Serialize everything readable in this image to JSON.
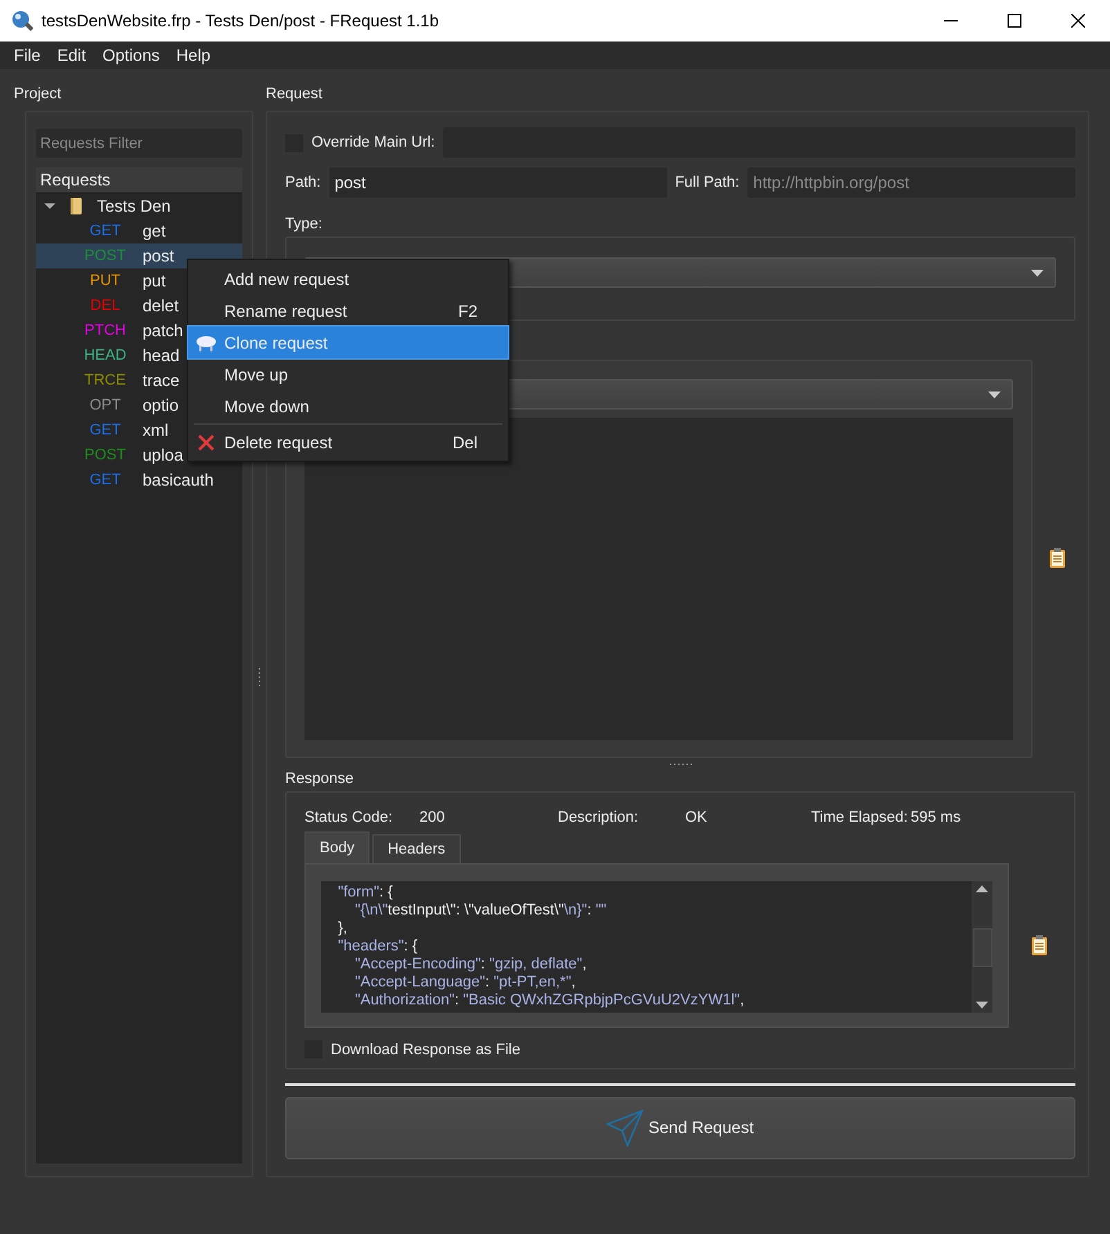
{
  "window": {
    "title": "testsDenWebsite.frp - Tests Den/post - FRequest 1.1b"
  },
  "menu": [
    "File",
    "Edit",
    "Options",
    "Help"
  ],
  "project": {
    "title": "Project",
    "filter_placeholder": "Requests Filter",
    "tree_header": "Requests",
    "tree": [
      {
        "label": "Tests Den",
        "expanded": true,
        "children": [
          {
            "method": "GET",
            "color": "#1e6ee6",
            "name": "get",
            "selected": false
          },
          {
            "method": "POST",
            "color": "#1e8c3c",
            "name": "post",
            "selected": true
          },
          {
            "method": "PUT",
            "color": "#e69600",
            "name": "put",
            "selected": false
          },
          {
            "method": "DEL",
            "color": "#e60000",
            "name": "delet",
            "selected": false
          },
          {
            "method": "PTCH",
            "color": "#e600e6",
            "name": "patch",
            "selected": false
          },
          {
            "method": "HEAD",
            "color": "#3cb482",
            "name": "head",
            "selected": false
          },
          {
            "method": "TRCE",
            "color": "#8c8c00",
            "name": "trace",
            "selected": false
          },
          {
            "method": "OPT",
            "color": "#8c8c8c",
            "name": "optio",
            "selected": false
          },
          {
            "method": "GET",
            "color": "#1e6ee6",
            "name": "xml",
            "selected": false
          },
          {
            "method": "POST",
            "color": "#1e8c1e",
            "name": "uploa",
            "selected": false
          },
          {
            "method": "GET",
            "color": "#1e6ee6",
            "name": "basicauth",
            "selected": false
          }
        ]
      }
    ]
  },
  "context_menu": [
    {
      "kind": "plain",
      "label": "Add new request",
      "selected": false
    },
    {
      "kind": "plain",
      "label": "Rename request",
      "shortcut": "F2",
      "selected": false
    },
    {
      "kind": "clone",
      "label": "Clone request",
      "selected": true
    },
    {
      "kind": "plain",
      "label": "Move up",
      "selected": false
    },
    {
      "kind": "plain",
      "label": "Move down",
      "selected": false
    },
    {
      "kind": "delete",
      "label": "Delete request",
      "shortcut": "Del",
      "selected": false,
      "separator_before": true
    }
  ],
  "request": {
    "title": "Request",
    "override_url": {
      "label": "Override Main Url:",
      "checked": false
    },
    "path": {
      "label": "Path:",
      "value": "post"
    },
    "full_path": {
      "label": "Full Path:",
      "value": "http://httpbin.org/post"
    },
    "type_label": "Type:"
  },
  "response": {
    "title": "Response",
    "status_code_label": "Status Code:",
    "status_code": "200",
    "description_label": "Description:",
    "description": "OK",
    "time_label": "Time Elapsed:",
    "time": "595 ms",
    "tabs": [
      {
        "label": "Body",
        "selected": true
      },
      {
        "label": "Headers",
        "selected": false
      }
    ],
    "body_lines": [
      [
        {
          "kind": "string",
          "t": "    \"form\""
        },
        {
          "kind": "punct",
          "t": ": {"
        }
      ],
      [
        {
          "kind": "string",
          "t": "        \"{\\n\\\""
        },
        {
          "kind": "punct",
          "t": "testInput\\\": \\\"valueOfTest\\\""
        },
        {
          "kind": "string",
          "t": "\\n}\""
        },
        {
          "kind": "punct",
          "t": ": "
        },
        {
          "kind": "string",
          "t": "\"\""
        }
      ],
      [
        {
          "kind": "punct",
          "t": "    },"
        }
      ],
      [
        {
          "kind": "string",
          "t": "    \"headers\""
        },
        {
          "kind": "punct",
          "t": ": {"
        }
      ],
      [
        {
          "kind": "string",
          "t": "        \"Accept-Encoding\""
        },
        {
          "kind": "punct",
          "t": ": "
        },
        {
          "kind": "string",
          "t": "\"gzip, deflate\""
        },
        {
          "kind": "punct",
          "t": ","
        }
      ],
      [
        {
          "kind": "string",
          "t": "        \"Accept-Language\""
        },
        {
          "kind": "punct",
          "t": ": "
        },
        {
          "kind": "string",
          "t": "\"pt-PT,en,*\""
        },
        {
          "kind": "punct",
          "t": ","
        }
      ],
      [
        {
          "kind": "string",
          "t": "        \"Authorization\""
        },
        {
          "kind": "punct",
          "t": ": "
        },
        {
          "kind": "string",
          "t": "\"Basic QWxhZGRpbjpPcGVuU2VzYW1l\""
        },
        {
          "kind": "punct",
          "t": ","
        }
      ]
    ],
    "download": {
      "label": "Download Response as File",
      "checked": false
    }
  },
  "send_button": "Send Request"
}
